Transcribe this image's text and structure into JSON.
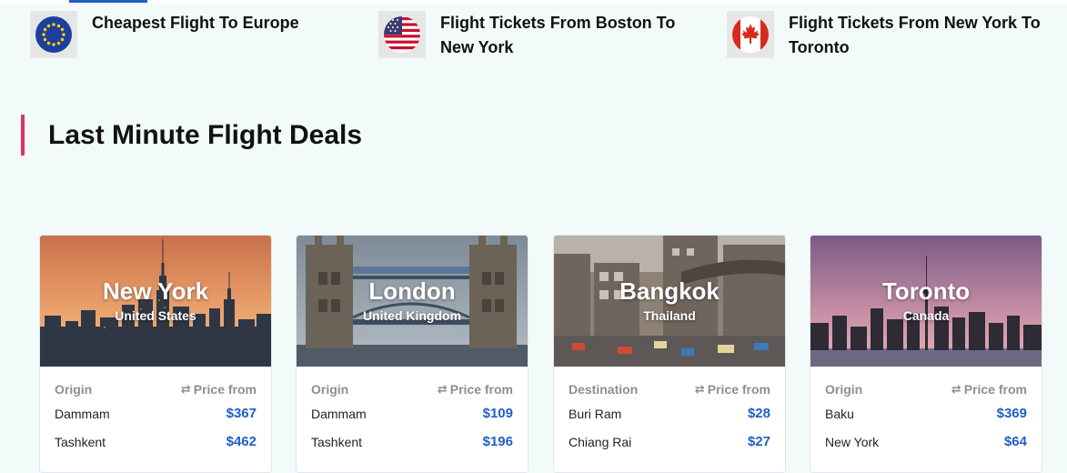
{
  "quick_links": [
    {
      "label_line1": "Cheapest Flight To Europe",
      "label_line2": "",
      "flag": "eu-flag-icon"
    },
    {
      "label_line1": "Flight Tickets From Boston To",
      "label_line2": "New York",
      "flag": "us-flag-icon"
    },
    {
      "label_line1": "Flight Tickets From New York To",
      "label_line2": "Toronto",
      "flag": "canada-flag-icon"
    }
  ],
  "section": {
    "title": "Last Minute Flight Deals"
  },
  "cards": [
    {
      "city": "New York",
      "country": "United States",
      "col_left": "Origin",
      "col_right": "Price from",
      "rows": [
        {
          "place": "Dammam",
          "price": "$367"
        },
        {
          "place": "Tashkent",
          "price": "$462"
        }
      ]
    },
    {
      "city": "London",
      "country": "United Kingdom",
      "col_left": "Origin",
      "col_right": "Price from",
      "rows": [
        {
          "place": "Dammam",
          "price": "$109"
        },
        {
          "place": "Tashkent",
          "price": "$196"
        }
      ]
    },
    {
      "city": "Bangkok",
      "country": "Thailand",
      "col_left": "Destination",
      "col_right": "Price from",
      "rows": [
        {
          "place": "Buri Ram",
          "price": "$28"
        },
        {
          "place": "Chiang Rai",
          "price": "$27"
        }
      ]
    },
    {
      "city": "Toronto",
      "country": "Canada",
      "col_left": "Origin",
      "col_right": "Price from",
      "rows": [
        {
          "place": "Baku",
          "price": "$369"
        },
        {
          "place": "New York",
          "price": "$64"
        }
      ]
    }
  ],
  "colors": {
    "accent_bar": "#e0325a",
    "price_blue": "#1f5fc4",
    "page_bg": "#f3fafa"
  }
}
